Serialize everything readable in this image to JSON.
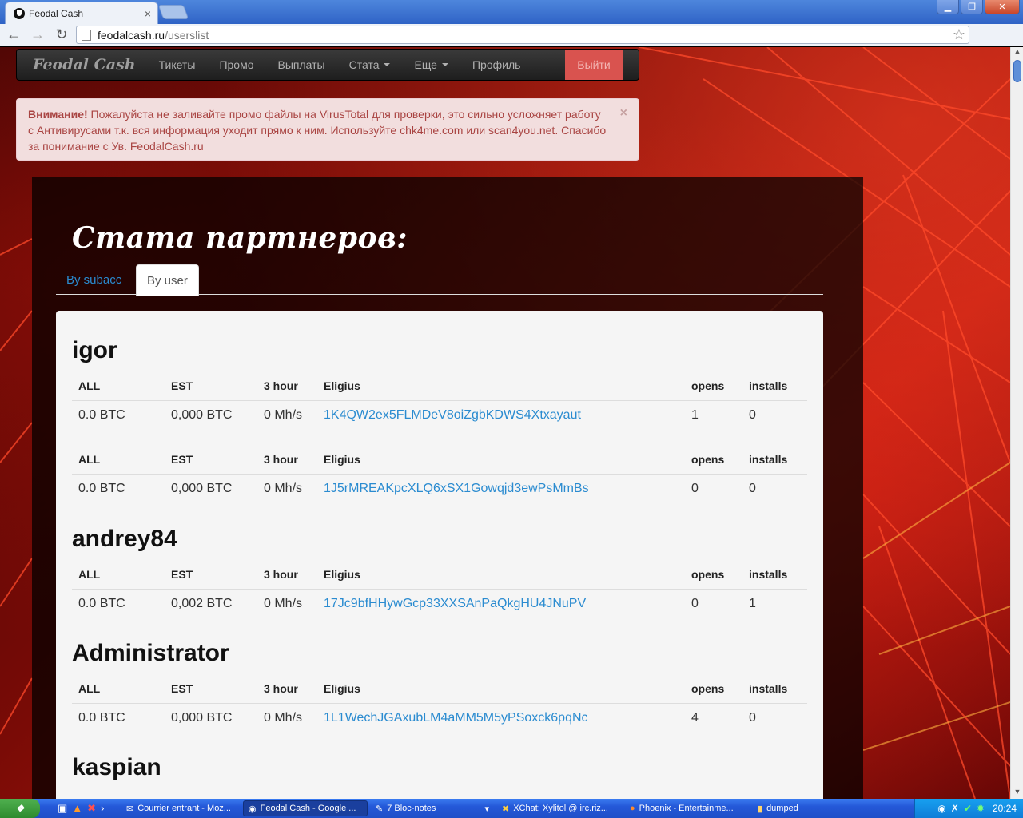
{
  "browser": {
    "tab_title": "Feodal Cash",
    "tab_close": "×",
    "url_host": "feodalcash.ru",
    "url_path": "/userslist",
    "window_buttons": [
      "▁",
      "❐",
      "✕"
    ]
  },
  "navbar": {
    "brand": "Feodal Cash",
    "links": [
      "Тикеты",
      "Промо",
      "Выплаты",
      "Стата",
      "Еще",
      "Профиль"
    ],
    "logout": "Выйти"
  },
  "alert": {
    "strong": "Внимание!",
    "text": " Пожалуйста не заливайте промо файлы на VirusTotal для проверки, это сильно усложняет работу с Антивирусами т.к. вся информация уходит прямо к ним. Используйте chk4me.com или scan4you.net. Спасибо за понимание с Ув. FeodalCash.ru",
    "close": "×"
  },
  "page": {
    "title": "Стата партнеров:",
    "tabs": [
      "By subacc",
      "By user"
    ]
  },
  "columns": [
    "ALL",
    "EST",
    "3 hour",
    "Eligius",
    "opens",
    "installs"
  ],
  "users": [
    {
      "name": "igor",
      "rows": [
        [
          "0.0 BTC",
          "0,000 BTC",
          "0 Mh/s",
          "1K4QW2ex5FLMDeV8oiZgbKDWS4Xtxayaut",
          "1",
          "0"
        ],
        [
          "0.0 BTC",
          "0,000 BTC",
          "0 Mh/s",
          "1J5rMREAKpcXLQ6xSX1Gowqjd3ewPsMmBs",
          "0",
          "0"
        ]
      ]
    },
    {
      "name": "andrey84",
      "rows": [
        [
          "0.0 BTC",
          "0,002 BTC",
          "0 Mh/s",
          "17Jc9bfHHywGcp33XXSAnPaQkgHU4JNuPV",
          "0",
          "1"
        ]
      ]
    },
    {
      "name": "Administrator",
      "rows": [
        [
          "0.0 BTC",
          "0,000 BTC",
          "0 Mh/s",
          "1L1WechJGAxubLM4aMM5M5yPSoxck6pqNc",
          "4",
          "0"
        ]
      ]
    },
    {
      "name": "kaspian",
      "rows": []
    }
  ],
  "taskbar": {
    "tasks": [
      "Courrier entrant - Moz...",
      "Feodal Cash - Google ...",
      "7 Bloc-notes",
      "XChat: Xylitol @ irc.riz...",
      "Phoenix - Entertainme...",
      "dumped"
    ],
    "clock": "20:24"
  }
}
